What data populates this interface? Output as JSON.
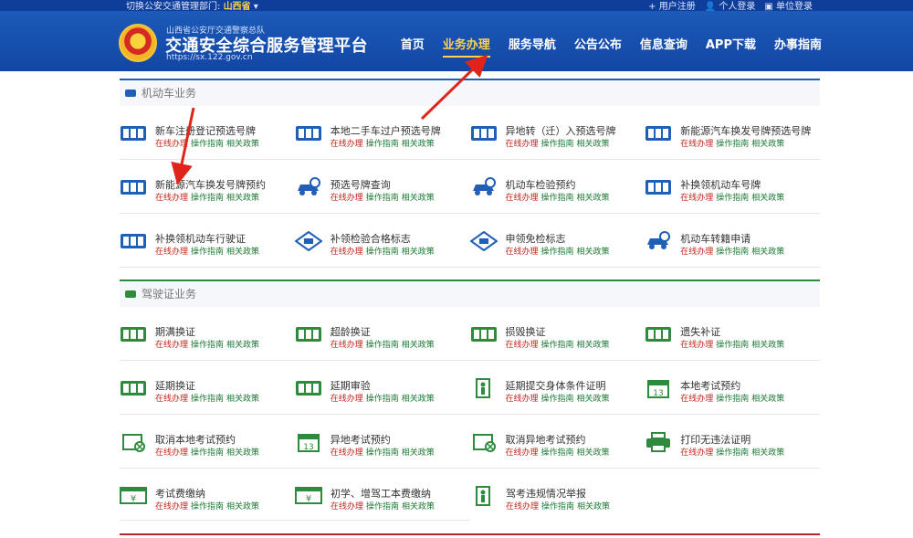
{
  "topbar": {
    "dept_label": "切换公安交通管理部门:",
    "province": "山西省",
    "links": [
      "+ 用户注册",
      "👤 个人登录",
      "▣ 单位登录"
    ]
  },
  "header": {
    "org": "山西省公安厅交通警察总队",
    "title": "交通安全综合服务管理平台",
    "url": "https://sx.122.gov.cn",
    "nav": [
      "首页",
      "业务办理",
      "服务导航",
      "公告公布",
      "信息查询",
      "APP下载",
      "办事指南"
    ],
    "active_nav": "业务办理"
  },
  "links": {
    "a": "在线办理",
    "b": "操作指南",
    "c": "相关政策"
  },
  "vehicle": {
    "title": "机动车业务",
    "rows": [
      [
        {
          "title": "新车注册登记预选号牌",
          "icon": "plate-icon"
        },
        {
          "title": "本地二手车过户预选号牌",
          "icon": "plate-icon"
        },
        {
          "title": "异地转（迁）入预选号牌",
          "icon": "plate-icon"
        },
        {
          "title": "新能源汽车换发号牌预选号牌",
          "icon": "plate-icon"
        }
      ],
      [
        {
          "title": "新能源汽车换发号牌预约",
          "icon": "ev-plate-icon"
        },
        {
          "title": "预选号牌查询",
          "icon": "car-icon"
        },
        {
          "title": "机动车检验预约",
          "icon": "inspect-icon"
        },
        {
          "title": "补换领机动车号牌",
          "icon": "plate-icon"
        }
      ],
      [
        {
          "title": "补换领机动车行驶证",
          "icon": "card-icon"
        },
        {
          "title": "补领检验合格标志",
          "icon": "badge-icon"
        },
        {
          "title": "申领免检标志",
          "icon": "badge-icon"
        },
        {
          "title": "机动车转籍申请",
          "icon": "inspect-icon"
        }
      ]
    ]
  },
  "license": {
    "title": "驾驶证业务",
    "rows": [
      [
        {
          "title": "期满换证",
          "icon": "license-icon"
        },
        {
          "title": "超龄换证",
          "icon": "license-icon"
        },
        {
          "title": "损毁换证",
          "icon": "license-icon"
        },
        {
          "title": "遗失补证",
          "icon": "license-icon"
        }
      ],
      [
        {
          "title": "延期换证",
          "icon": "license-icon"
        },
        {
          "title": "延期审验",
          "icon": "license-icon"
        },
        {
          "title": "延期提交身体条件证明",
          "icon": "person-icon"
        },
        {
          "title": "本地考试预约",
          "icon": "calendar-icon"
        }
      ],
      [
        {
          "title": "取消本地考试预约",
          "icon": "cancel-icon"
        },
        {
          "title": "异地考试预约",
          "icon": "calendar-icon"
        },
        {
          "title": "取消异地考试预约",
          "icon": "cancel-icon"
        },
        {
          "title": "打印无违法证明",
          "icon": "printer-icon"
        }
      ],
      [
        {
          "title": "考试费缴纳",
          "icon": "yuan-icon"
        },
        {
          "title": "初学、增驾工本费缴纳",
          "icon": "yuan-icon"
        },
        {
          "title": "驾考违规情况举报",
          "icon": "person-icon"
        }
      ]
    ]
  },
  "colors": {
    "header": "#1346a4",
    "active": "#ffd34a",
    "red": "#c2261c",
    "green": "#1d7a35",
    "arrow": "#e0241c"
  }
}
